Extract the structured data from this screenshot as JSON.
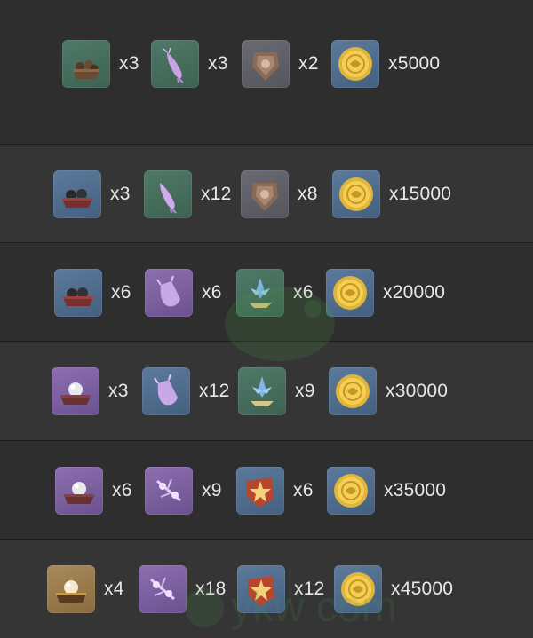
{
  "rows": [
    {
      "items": [
        {
          "icon": "chest-item-icon",
          "bg": "green",
          "qty": "x3"
        },
        {
          "icon": "squid-item-icon",
          "bg": "green",
          "qty": "x3"
        },
        {
          "icon": "emblem-item-icon",
          "bg": "gray",
          "qty": "x2"
        },
        {
          "icon": "mora-coin-icon",
          "bg": "blue",
          "qty": "x5000"
        }
      ]
    },
    {
      "items": [
        {
          "icon": "chest-item-icon",
          "bg": "blue",
          "qty": "x3"
        },
        {
          "icon": "squid-item-icon",
          "bg": "green",
          "qty": "x12"
        },
        {
          "icon": "emblem-item-icon",
          "bg": "gray",
          "qty": "x8"
        },
        {
          "icon": "mora-coin-icon",
          "bg": "blue",
          "qty": "x15000"
        }
      ]
    },
    {
      "items": [
        {
          "icon": "chest-item-icon",
          "bg": "blue",
          "qty": "x6"
        },
        {
          "icon": "pouch-item-icon",
          "bg": "purple",
          "qty": "x6"
        },
        {
          "icon": "crystal-item-icon",
          "bg": "green",
          "qty": "x6"
        },
        {
          "icon": "mora-coin-icon",
          "bg": "blue",
          "qty": "x20000"
        }
      ]
    },
    {
      "items": [
        {
          "icon": "pearl-chest-item-icon",
          "bg": "purple",
          "qty": "x3"
        },
        {
          "icon": "pouch-item-icon",
          "bg": "blue",
          "qty": "x12"
        },
        {
          "icon": "crystal-item-icon",
          "bg": "green",
          "qty": "x9"
        },
        {
          "icon": "mora-coin-icon",
          "bg": "blue",
          "qty": "x30000"
        }
      ]
    },
    {
      "items": [
        {
          "icon": "pearl-chest-item-icon",
          "bg": "purple",
          "qty": "x6"
        },
        {
          "icon": "charm-item-icon",
          "bg": "purple",
          "qty": "x9"
        },
        {
          "icon": "star-emblem-item-icon",
          "bg": "blue",
          "qty": "x6"
        },
        {
          "icon": "mora-coin-icon",
          "bg": "blue",
          "qty": "x35000"
        }
      ]
    },
    {
      "items": [
        {
          "icon": "pearl-chest-item-icon",
          "bg": "gold",
          "qty": "x4"
        },
        {
          "icon": "charm-item-icon",
          "bg": "purple",
          "qty": "x18"
        },
        {
          "icon": "star-emblem-item-icon",
          "bg": "blue",
          "qty": "x12"
        },
        {
          "icon": "mora-coin-icon",
          "bg": "blue",
          "qty": "x45000"
        }
      ]
    }
  ],
  "watermark": {
    "text": "ykw  com"
  }
}
